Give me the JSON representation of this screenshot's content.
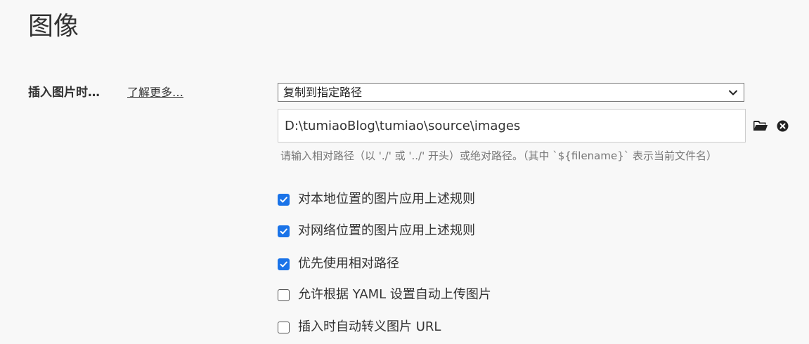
{
  "page": {
    "title": "图像"
  },
  "insert_image": {
    "label": "插入图片时…",
    "learn_more": "了解更多…",
    "select_value": "复制到指定路径",
    "path_value": "D:\\tumiaoBlog\\tumiao\\source\\images",
    "hint": "请输入相对路径（以 './' 或 '../' 开头）或绝对路径。（其中 `${filename}` 表示当前文件名）"
  },
  "options": [
    {
      "label": "对本地位置的图片应用上述规则",
      "checked": true
    },
    {
      "label": "对网络位置的图片应用上述规则",
      "checked": true
    },
    {
      "label": "优先使用相对路径",
      "checked": true
    },
    {
      "label": "允许根据 YAML 设置自动上传图片",
      "checked": false
    },
    {
      "label": "插入时自动转义图片 URL",
      "checked": false
    }
  ],
  "icons": {
    "chevron": "chevron-down-icon",
    "folder": "folder-icon",
    "clear": "clear-circle-icon",
    "check": "checkmark-icon"
  },
  "colors": {
    "checkbox_checked": "#1a73e8",
    "background": "#f8f8f8"
  }
}
